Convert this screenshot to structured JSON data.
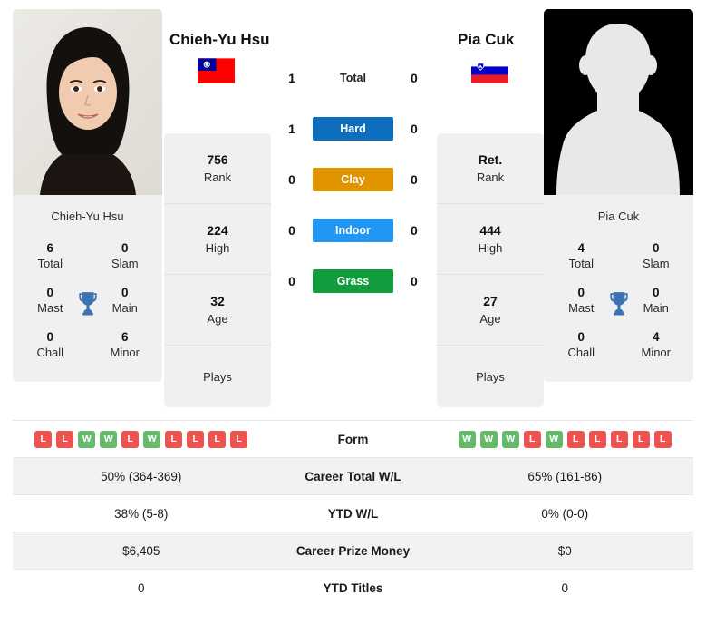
{
  "players": {
    "left": {
      "name": "Chieh-Yu Hsu",
      "card_name": "Chieh-Yu Hsu",
      "flag": "taiwan-flag",
      "photo": "player-photo",
      "titles": {
        "total_value": "6",
        "total_label": "Total",
        "slam_value": "0",
        "slam_label": "Slam",
        "mast_value": "0",
        "mast_label": "Mast",
        "main_value": "0",
        "main_label": "Main",
        "chall_value": "0",
        "chall_label": "Chall",
        "minor_value": "6",
        "minor_label": "Minor"
      },
      "rank_value": "756",
      "rank_label": "Rank",
      "high_value": "224",
      "high_label": "High",
      "age_value": "32",
      "age_label": "Age",
      "plays_label": "Plays",
      "form": [
        "L",
        "L",
        "W",
        "W",
        "L",
        "W",
        "L",
        "L",
        "L",
        "L"
      ],
      "career_wl": "50% (364-369)",
      "ytd_wl": "38% (5-8)",
      "career_prize": "$6,405",
      "ytd_titles": "0"
    },
    "right": {
      "name": "Pia Cuk",
      "card_name": "Pia Cuk",
      "flag": "slovenia-flag",
      "photo": "player-photo-placeholder",
      "titles": {
        "total_value": "4",
        "total_label": "Total",
        "slam_value": "0",
        "slam_label": "Slam",
        "mast_value": "0",
        "mast_label": "Mast",
        "main_value": "0",
        "main_label": "Main",
        "chall_value": "0",
        "chall_label": "Chall",
        "minor_value": "4",
        "minor_label": "Minor"
      },
      "rank_value": "Ret.",
      "rank_label": "Rank",
      "high_value": "444",
      "high_label": "High",
      "age_value": "27",
      "age_label": "Age",
      "plays_label": "Plays",
      "form": [
        "W",
        "W",
        "W",
        "L",
        "W",
        "L",
        "L",
        "L",
        "L",
        "L"
      ],
      "career_wl": "65% (161-86)",
      "ytd_wl": "0% (0-0)",
      "career_prize": "$0",
      "ytd_titles": "0"
    }
  },
  "head_to_head": [
    {
      "label": "Total",
      "left": "1",
      "right": "0",
      "style": "plain",
      "color": ""
    },
    {
      "label": "Hard",
      "left": "1",
      "right": "0",
      "style": "badge",
      "color": "#0d6ebd"
    },
    {
      "label": "Clay",
      "left": "0",
      "right": "0",
      "style": "badge",
      "color": "#e09400"
    },
    {
      "label": "Indoor",
      "left": "0",
      "right": "0",
      "style": "badge",
      "color": "#2196f3"
    },
    {
      "label": "Grass",
      "left": "0",
      "right": "0",
      "style": "badge",
      "color": "#119c3d"
    }
  ],
  "table": {
    "rows": [
      {
        "label": "Form",
        "type": "form",
        "left": "",
        "right": ""
      },
      {
        "label": "Career Total W/L",
        "type": "text",
        "left": "50% (364-369)",
        "right": "65% (161-86)"
      },
      {
        "label": "YTD W/L",
        "type": "text",
        "left": "38% (5-8)",
        "right": "0% (0-0)"
      },
      {
        "label": "Career Prize Money",
        "type": "text",
        "left": "$6,405",
        "right": "$0"
      },
      {
        "label": "YTD Titles",
        "type": "text",
        "left": "0",
        "right": "0"
      }
    ]
  },
  "colors": {
    "win": "#66bb6a",
    "loss": "#ef5350",
    "trophy": "#3b72b0",
    "card_bg": "#f0f0f0",
    "row_alt": "#f2f2f2"
  }
}
